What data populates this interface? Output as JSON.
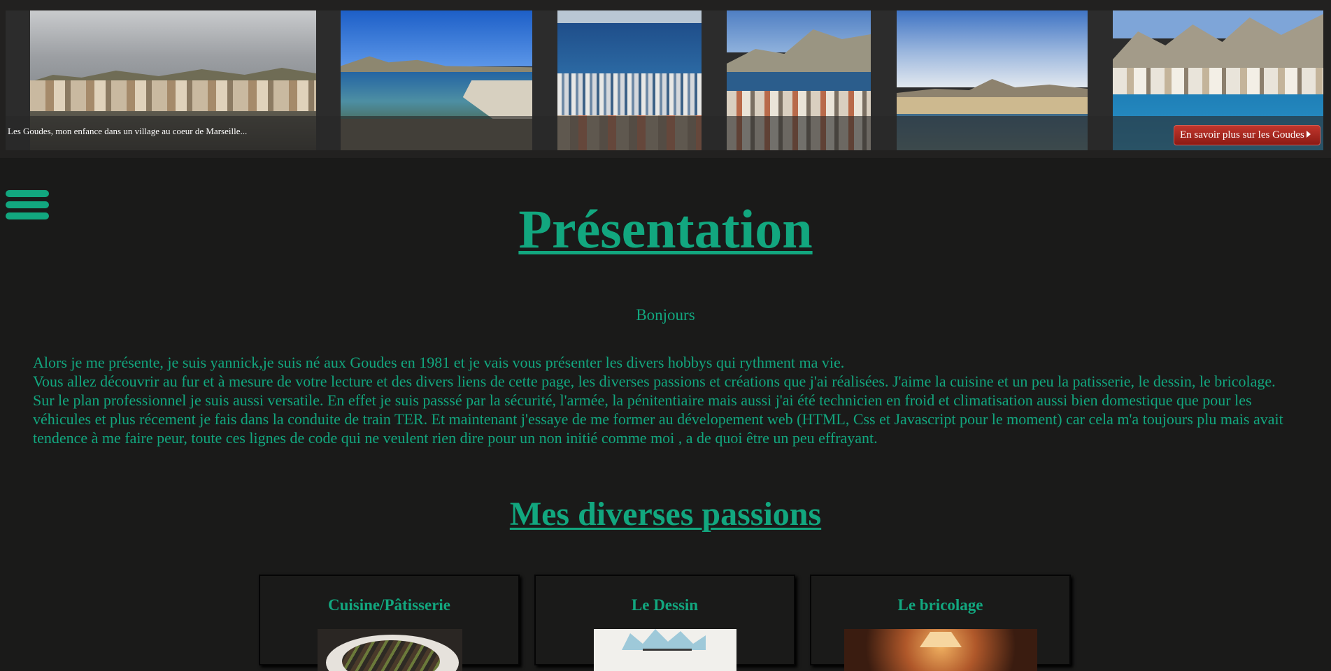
{
  "banner": {
    "caption": "Les Goudes, mon enfance dans un village au coeur de Marseille...",
    "more_button": "En savoir plus sur les Goudes",
    "photos": [
      "Les Goudes village and harbour under cloudy sky",
      "Harbour entrance with rocky breakwater",
      "Marina seen from above with the sea",
      "Village and marina below the hills",
      "Seafront village under a cloudy sky",
      "Bay with boats and limestone cliffs"
    ]
  },
  "menu": {
    "icon": "menu-icon"
  },
  "main": {
    "title": "Présentation",
    "greeting": "Bonjours",
    "intro_line1": "Alors je me présente, je suis yannick,je suis né aux Goudes en 1981 et je vais vous présenter les divers hobbys qui rythment ma vie.",
    "intro_line2": "Vous allez découvrir au fur et à mesure de votre lecture et des divers liens de cette page, les diverses passions et créations que j'ai réalisées. J'aime la cuisine et un peu la patisserie, le dessin, le bricolage. Sur le plan professionnel je suis aussi versatile. En effet je suis passsé par la sécurité, l'armée, la pénitentiaire mais aussi j'ai été technicien en froid et climatisation aussi bien domestique que pour les véhicules et plus récement je fais dans la conduite de train TER. Et maintenant j'essaye de me former au dévelopement web (HTML, Css et Javascript pour le moment) car cela m'a toujours plu mais avait tendence à me faire peur, toute ces lignes de code qui ne veulent rien dire pour un non initié comme moi , a de quoi être un peu effrayant.",
    "passions_title": "Mes diverses passions"
  },
  "passions": [
    {
      "title": "Cuisine/Pâtisserie"
    },
    {
      "title": "Le Dessin"
    },
    {
      "title": "Le bricolage"
    }
  ],
  "colors": {
    "accent": "#12a77f",
    "background": "#1a1a19",
    "button": "#a7261f"
  }
}
